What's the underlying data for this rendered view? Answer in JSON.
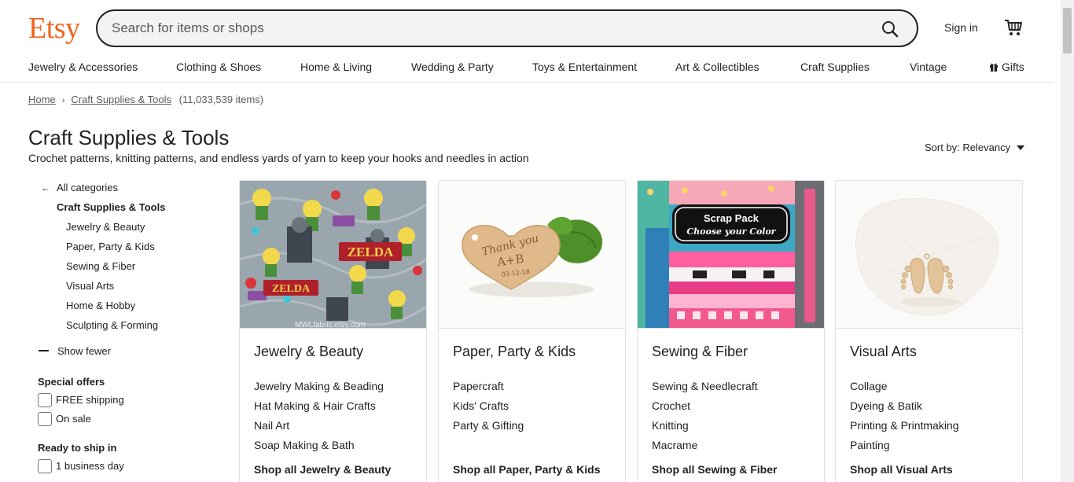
{
  "header": {
    "logo": "Etsy",
    "search_placeholder": "Search for items or shops",
    "sign_in": "Sign in"
  },
  "nav": {
    "items": [
      "Jewelry & Accessories",
      "Clothing & Shoes",
      "Home & Living",
      "Wedding & Party",
      "Toys & Entertainment",
      "Art & Collectibles",
      "Craft Supplies",
      "Vintage",
      "Gifts"
    ]
  },
  "breadcrumb": {
    "home": "Home",
    "current": "Craft Supplies & Tools",
    "count": "(11,033,539 items)"
  },
  "page": {
    "title": "Craft Supplies & Tools",
    "description": "Crochet patterns, knitting patterns, and endless yards of yarn to keep your hooks and needles in action",
    "sort": "Sort by: Relevancy"
  },
  "sidebar": {
    "all_categories": "All categories",
    "current_category": "Craft Supplies & Tools",
    "subcategories": [
      "Jewelry & Beauty",
      "Paper, Party & Kids",
      "Sewing & Fiber",
      "Visual Arts",
      "Home & Hobby",
      "Sculpting & Forming"
    ],
    "show_fewer": "Show fewer",
    "special_offers": {
      "heading": "Special offers",
      "options": [
        "FREE shipping",
        "On sale"
      ]
    },
    "ready_to_ship": {
      "heading": "Ready to ship in",
      "options": [
        "1 business day"
      ]
    }
  },
  "cards": [
    {
      "title": "Jewelry & Beauty",
      "links": [
        "Jewelry Making & Beading",
        "Hat Making & Hair Crafts",
        "Nail Art",
        "Soap Making & Bath"
      ],
      "shop_all": "Shop all Jewelry & Beauty",
      "image_text": [
        "ZELDA",
        "ZELDA",
        "MWLfabric.etsy.com"
      ]
    },
    {
      "title": "Paper, Party & Kids",
      "links": [
        "Papercraft",
        "Kids' Crafts",
        "Party & Gifting"
      ],
      "shop_all": "Shop all Paper, Party & Kids",
      "image_text": [
        "Thank you",
        "A+B",
        "03-12-18"
      ]
    },
    {
      "title": "Sewing & Fiber",
      "links": [
        "Sewing & Needlecraft",
        "Crochet",
        "Knitting",
        "Macrame"
      ],
      "shop_all": "Shop all Sewing & Fiber",
      "image_text": [
        "Scrap Pack",
        "Choose your Color"
      ]
    },
    {
      "title": "Visual Arts",
      "links": [
        "Collage",
        "Dyeing & Batik",
        "Printing & Printmaking",
        "Painting"
      ],
      "shop_all": "Shop all Visual Arts",
      "image_text": []
    }
  ],
  "colors": {
    "brand": "#f1641e",
    "text": "#222222",
    "border": "#e1e3df"
  }
}
